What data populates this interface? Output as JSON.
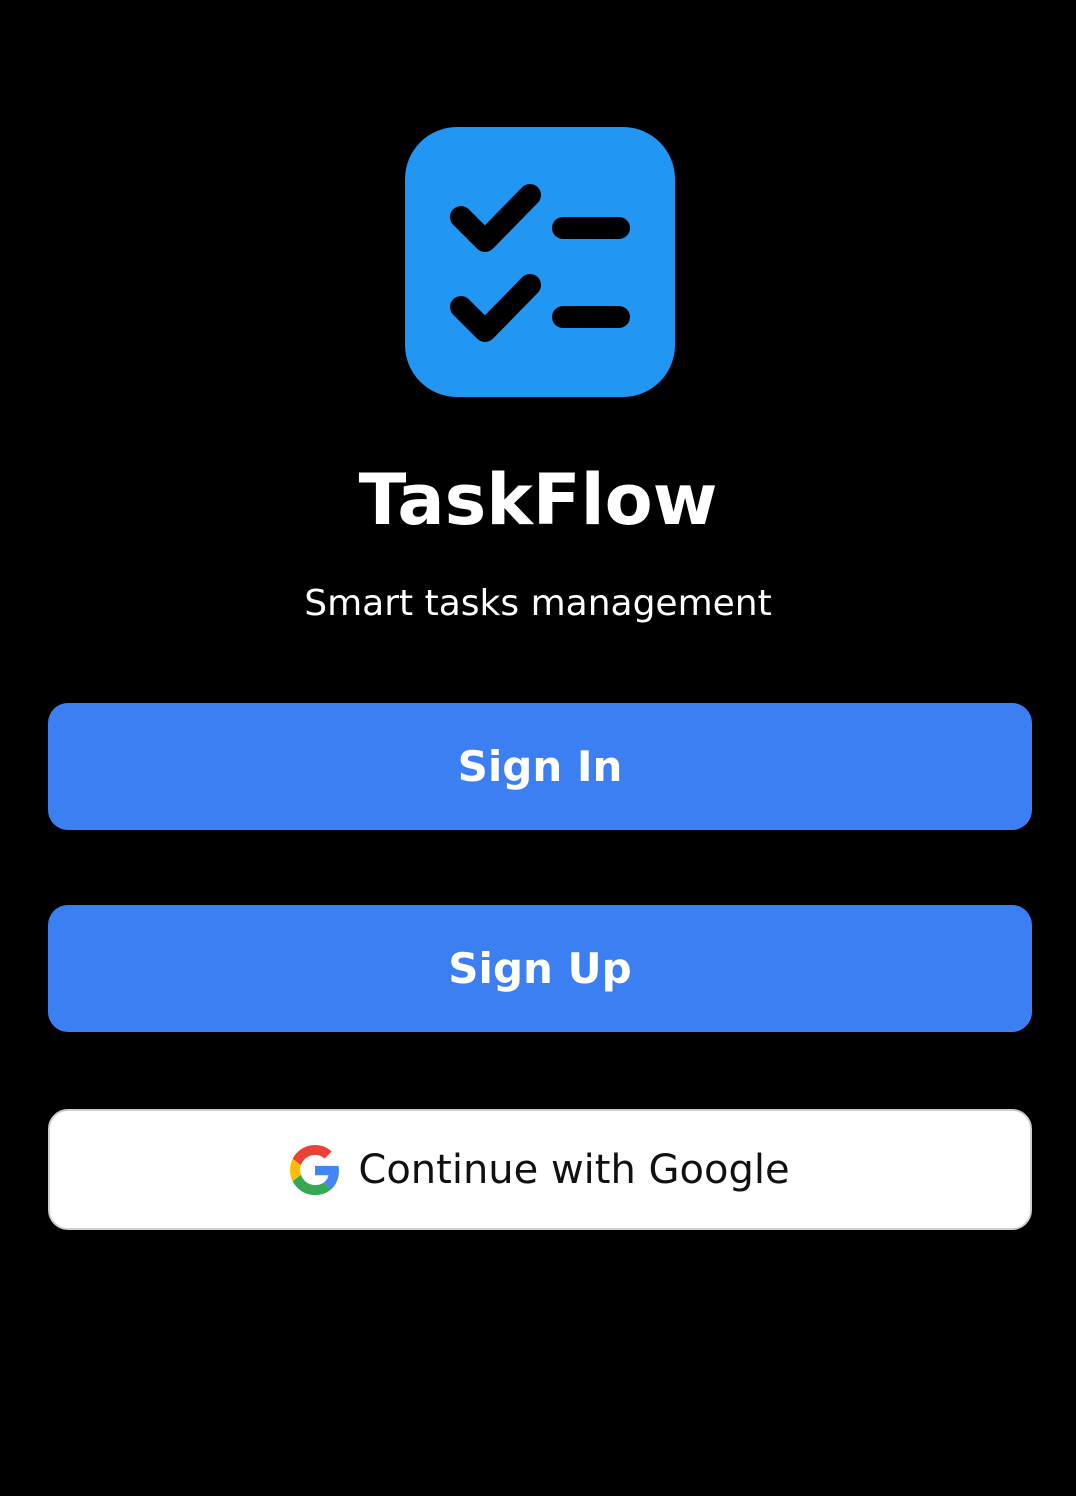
{
  "app": {
    "name": "TaskFlow",
    "tagline": "Smart tasks management",
    "icon": "task-checklist-icon",
    "brand_color": "#2196F3"
  },
  "actions": {
    "sign_in_label": "Sign In",
    "sign_up_label": "Sign Up",
    "google_label": "Continue with Google",
    "google_icon": "google-g-icon",
    "primary_color": "#3B7FF2"
  }
}
